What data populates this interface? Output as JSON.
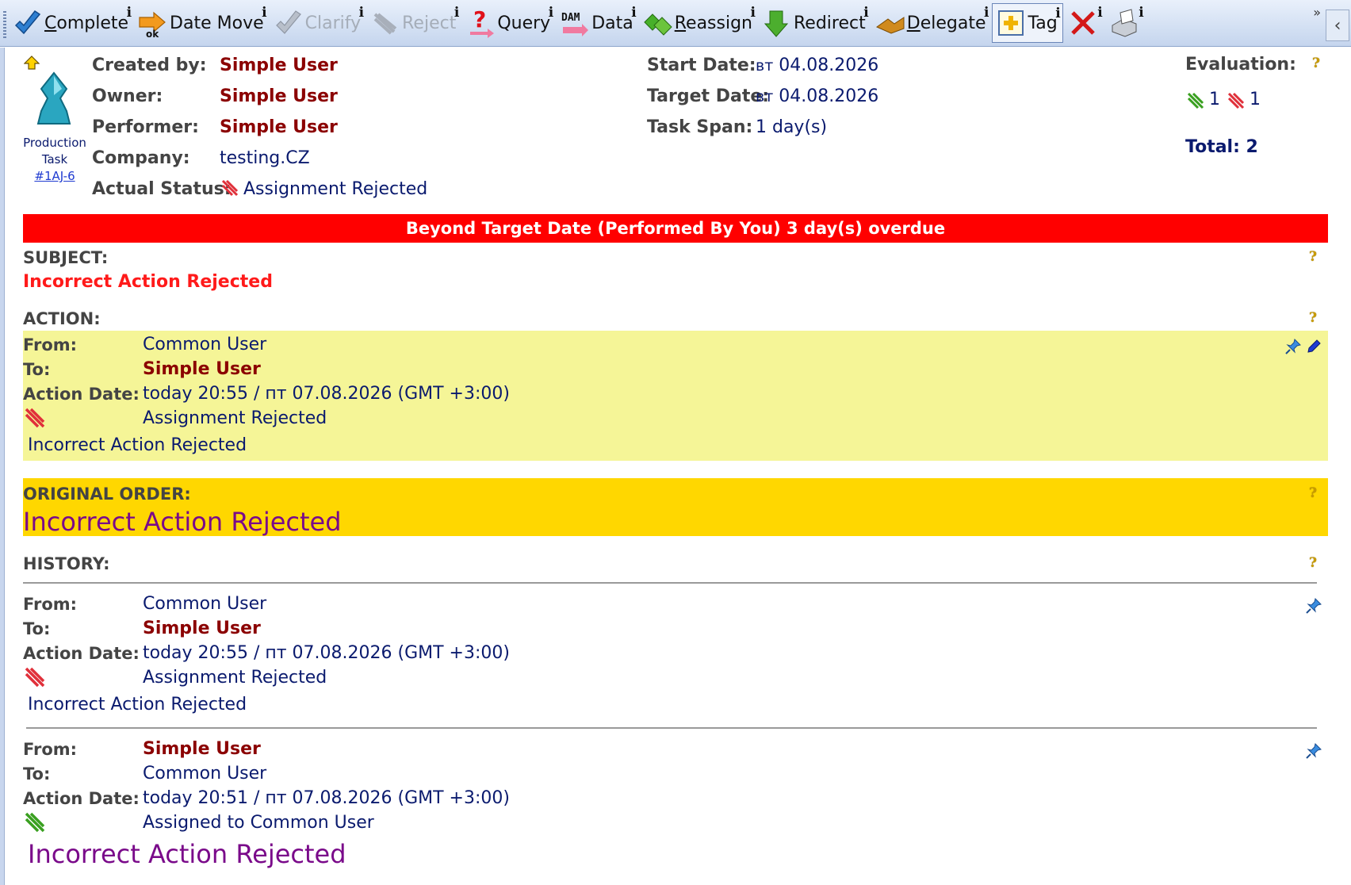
{
  "toolbar": {
    "buttons": [
      {
        "label": "Complete",
        "underline": "C",
        "rest": "omplete",
        "icon": "complete-icon",
        "disabled": false
      },
      {
        "label": "Date Move",
        "underline": "",
        "rest": "Date Move",
        "icon": "date-move-icon",
        "disabled": false
      },
      {
        "label": "Clarify",
        "underline": "",
        "rest": "Clarify",
        "icon": "clarify-icon",
        "disabled": true
      },
      {
        "label": "Reject",
        "underline": "",
        "rest": "Reject",
        "icon": "reject-icon",
        "disabled": true
      },
      {
        "label": "Query",
        "underline": "",
        "rest": "Query",
        "icon": "query-icon",
        "disabled": false
      },
      {
        "label": "Data",
        "underline": "",
        "rest": "Data",
        "icon": "data-icon",
        "disabled": false
      },
      {
        "label": "Reassign",
        "underline": "R",
        "rest": "eassign",
        "icon": "reassign-icon",
        "disabled": false
      },
      {
        "label": "Redirect",
        "underline": "",
        "rest": "Redirect",
        "icon": "redirect-icon",
        "disabled": false
      },
      {
        "label": "Delegate",
        "underline": "D",
        "rest": "elegate",
        "icon": "delegate-icon",
        "disabled": false
      },
      {
        "label": "Tag",
        "underline": "",
        "rest": "Tag",
        "icon": "tag-icon",
        "disabled": false
      },
      {
        "label": "",
        "underline": "",
        "rest": "",
        "icon": "delete-icon",
        "disabled": false
      },
      {
        "label": "",
        "underline": "",
        "rest": "",
        "icon": "print-icon",
        "disabled": false
      }
    ],
    "info_glyph": "i",
    "more_glyph": "»",
    "collapse_glyph": "‹",
    "date_move_sub": "ok",
    "data_sub": "DAM"
  },
  "task": {
    "kind_line1": "Production",
    "kind_line2": "Task",
    "id": "#1AJ-6",
    "created_by_label": "Created by:",
    "created_by": "Simple User",
    "owner_label": "Owner:",
    "owner": "Simple User",
    "performer_label": "Performer:",
    "performer": "Simple User",
    "company_label": "Company:",
    "company": "testing.CZ",
    "status_label": "Actual Status:",
    "status": "Assignment Rejected",
    "start_label": "Start Date:",
    "start_dow": "вт",
    "start_date": "04.08.2026",
    "target_label": "Target Date:",
    "target_dow": "вт",
    "target_date": "04.08.2026",
    "span_label": "Task Span:",
    "span": "1 day(s)"
  },
  "evaluation": {
    "label": "Evaluation:",
    "positive": "1",
    "negative": "1",
    "total": "Total: 2"
  },
  "help_glyph": "?",
  "banner": "Beyond Target Date (Performed By You) 3 day(s) overdue",
  "subject": {
    "title": "SUBJECT:",
    "text": "Incorrect Action Rejected"
  },
  "action": {
    "title": "ACTION:",
    "from_label": "From:",
    "from": "Common User",
    "to_label": "To:",
    "to": "Simple User",
    "date_label": "Action Date:",
    "date": "today 20:55 / пт 07.08.2026 (GMT +3:00)",
    "status": "Assignment Rejected",
    "message": "Incorrect Action Rejected"
  },
  "original_order": {
    "title": "ORIGINAL ORDER:",
    "text": "Incorrect Action Rejected"
  },
  "history": {
    "title": "HISTORY:",
    "entries": [
      {
        "from_label": "From:",
        "from": "Common User",
        "to_label": "To:",
        "to": "Simple User",
        "date_label": "Action Date:",
        "date": "today 20:55 / пт 07.08.2026 (GMT +3:00)",
        "status": "Assignment Rejected",
        "message": "Incorrect Action Rejected"
      },
      {
        "from_label": "From:",
        "from": "Simple User",
        "to_label": "To:",
        "to": "Common User",
        "date_label": "Action Date:",
        "date": "today 20:51 / пт 07.08.2026 (GMT +3:00)",
        "status": "Assigned to Common User",
        "message": "Incorrect Action Rejected"
      }
    ]
  },
  "colors": {
    "banner": "#ff0000",
    "action_bg": "#f5f597",
    "order_bg": "#ffd700",
    "user_red": "#8b0000",
    "text_blue": "#0a1a6e",
    "purple": "#7a0a8a"
  }
}
